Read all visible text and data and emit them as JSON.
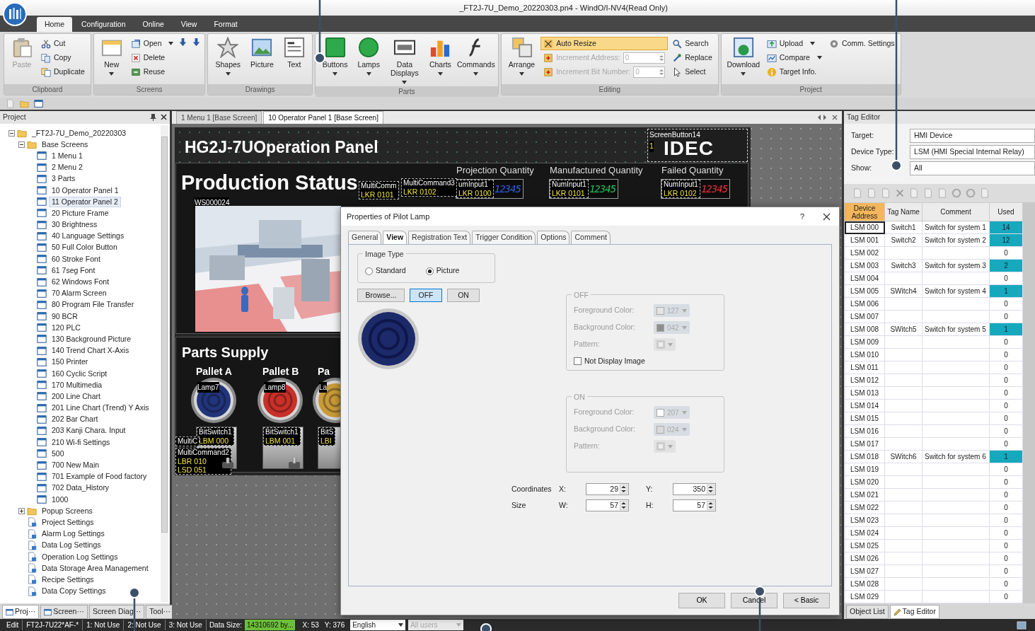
{
  "window": {
    "title": "_FT2J-7U_Demo_20220303.pn4 - WindO/I-NV4(Read Only)"
  },
  "ribbon_tabs": [
    {
      "label": "Home",
      "selected": true
    },
    {
      "label": "Configuration",
      "selected": false
    },
    {
      "label": "Online",
      "selected": false
    },
    {
      "label": "View",
      "selected": false
    },
    {
      "label": "Format",
      "selected": false
    }
  ],
  "ribbon_groups": [
    {
      "label": "Clipboard",
      "columns": [
        [
          {
            "kind": "large",
            "label": "Paste",
            "disabled": true
          }
        ],
        [
          {
            "kind": "small",
            "label": "Cut"
          },
          {
            "kind": "small",
            "label": "Copy"
          },
          {
            "kind": "small",
            "label": "Duplicate"
          }
        ]
      ]
    },
    {
      "label": "Screens",
      "columns": [
        [
          {
            "kind": "large",
            "label": "New",
            "dropdown": true
          }
        ],
        [
          {
            "kind": "small",
            "label": "Open",
            "dropdown": true
          },
          {
            "kind": "small",
            "label": "Delete"
          },
          {
            "kind": "small",
            "label": "Reuse"
          }
        ],
        [
          {
            "kind": "icon"
          },
          {
            "kind": "icon"
          }
        ]
      ]
    },
    {
      "label": "Drawings",
      "columns": [
        [
          {
            "kind": "large",
            "label": "Shapes",
            "dropdown": true
          }
        ],
        [
          {
            "kind": "large",
            "label": "Picture"
          }
        ],
        [
          {
            "kind": "large",
            "label": "Text"
          }
        ]
      ]
    },
    {
      "label": "Parts",
      "columns": [
        [
          {
            "kind": "large",
            "label": "Buttons",
            "dropdown": true
          }
        ],
        [
          {
            "kind": "large",
            "label": "Lamps",
            "dropdown": true
          }
        ],
        [
          {
            "kind": "large",
            "label": "Data Displays",
            "dropdown": true
          }
        ],
        [
          {
            "kind": "large",
            "label": "Charts",
            "dropdown": true
          }
        ],
        [
          {
            "kind": "large",
            "label": "Commands",
            "dropdown": true
          }
        ]
      ]
    },
    {
      "label": "Editing",
      "columns": [
        [
          {
            "kind": "large",
            "label": "Arrange",
            "dropdown": true
          }
        ],
        [
          {
            "kind": "small",
            "label": "Auto Resize",
            "highlighted": true
          },
          {
            "kind": "spin",
            "label": "Increment Address:",
            "value": "0",
            "disabled": true
          },
          {
            "kind": "spin",
            "label": "Increment Bit Number:",
            "value": "0",
            "disabled": true
          }
        ],
        [
          {
            "kind": "small",
            "label": "Search"
          },
          {
            "kind": "small",
            "label": "Replace"
          },
          {
            "kind": "small",
            "label": "Select"
          }
        ]
      ]
    },
    {
      "label": "Project",
      "columns": [
        [
          {
            "kind": "large",
            "label": "Download",
            "dropdown": true
          }
        ],
        [
          {
            "kind": "small",
            "label": "Upload",
            "dropdown": true
          },
          {
            "kind": "small",
            "label": "Compare",
            "dropdown": true
          },
          {
            "kind": "small",
            "label": "Target Info."
          }
        ],
        [
          {
            "kind": "small",
            "label": "Comm. Settings"
          }
        ]
      ]
    }
  ],
  "project": {
    "title": "Project",
    "tree": [
      {
        "label": "_FT2J-7U_Demo_20220303",
        "kind": "folder",
        "expanded": true,
        "selected": false,
        "children": [
          {
            "label": "Base Screens",
            "kind": "folder",
            "expanded": true,
            "selected": false,
            "children": [
              {
                "label": "1 Menu 1",
                "kind": "screen",
                "selected": false
              },
              {
                "label": "2 Menu 2",
                "kind": "screen",
                "selected": false
              },
              {
                "label": "3 Parts",
                "kind": "screen",
                "selected": false
              },
              {
                "label": "10 Operator Panel 1",
                "kind": "screen",
                "selected": false
              },
              {
                "label": "11 Operator Panel 2",
                "kind": "screen",
                "selected": true
              },
              {
                "label": "20 Picture Frame",
                "kind": "screen",
                "selected": false
              },
              {
                "label": "30 Brightness",
                "kind": "screen",
                "selected": false
              },
              {
                "label": "40 Language Settings",
                "kind": "screen",
                "selected": false
              },
              {
                "label": "50 Full Color Button",
                "kind": "screen",
                "selected": false
              },
              {
                "label": "60 Stroke Font",
                "kind": "screen",
                "selected": false
              },
              {
                "label": "61 7seg Font",
                "kind": "screen",
                "selected": false
              },
              {
                "label": "62 Windows Font",
                "kind": "screen",
                "selected": false
              },
              {
                "label": "70 Alarm Screen",
                "kind": "screen",
                "selected": false
              },
              {
                "label": "80 Program File Transfer",
                "kind": "screen",
                "selected": false
              },
              {
                "label": "90 BCR",
                "kind": "screen",
                "selected": false
              },
              {
                "label": "120 PLC",
                "kind": "screen",
                "selected": false
              },
              {
                "label": "130 Background Picture",
                "kind": "screen",
                "selected": false
              },
              {
                "label": "140 Trend Chart X-Axis",
                "kind": "screen",
                "selected": false
              },
              {
                "label": "150 Printer",
                "kind": "screen",
                "selected": false
              },
              {
                "label": "160 Cyclic Script",
                "kind": "screen",
                "selected": false
              },
              {
                "label": "170 Multimedia",
                "kind": "screen",
                "selected": false
              },
              {
                "label": "200 Line Chart",
                "kind": "screen",
                "selected": false
              },
              {
                "label": "201 Line Chart (Trend) Y Axis",
                "kind": "screen",
                "selected": false
              },
              {
                "label": "202 Bar Chart",
                "kind": "screen",
                "selected": false
              },
              {
                "label": "203 Kanji Chara. Input",
                "kind": "screen",
                "selected": false
              },
              {
                "label": "210 Wi-fi Settings",
                "kind": "screen",
                "selected": false
              },
              {
                "label": "500",
                "kind": "screen",
                "selected": false
              },
              {
                "label": "700 New Main",
                "kind": "screen",
                "selected": false
              },
              {
                "label": "701 Example of Food factory",
                "kind": "screen",
                "selected": false
              },
              {
                "label": "702 Data_History",
                "kind": "screen",
                "selected": false
              },
              {
                "label": "1000",
                "kind": "screen",
                "selected": false
              }
            ]
          },
          {
            "label": "Popup Screens",
            "kind": "folder",
            "expanded": false,
            "selected": false
          },
          {
            "label": "Project Settings",
            "kind": "settings",
            "selected": false
          },
          {
            "label": "Alarm Log Settings",
            "kind": "settings",
            "selected": false
          },
          {
            "label": "Data Log Settings",
            "kind": "settings",
            "selected": false
          },
          {
            "label": "Operation Log Settings",
            "kind": "settings",
            "selected": false
          },
          {
            "label": "Data Storage Area Management",
            "kind": "settings",
            "selected": false
          },
          {
            "label": "Recipe Settings",
            "kind": "settings",
            "selected": false
          },
          {
            "label": "Data Copy Settings",
            "kind": "settings",
            "selected": false
          }
        ]
      }
    ],
    "tabs": [
      {
        "label": "Proj···",
        "selected": true
      },
      {
        "label": "Screen···",
        "selected": false
      },
      {
        "label": "Screen Diag···",
        "selected": false
      },
      {
        "label": "Tool···",
        "selected": false
      }
    ]
  },
  "editor": {
    "tabs": [
      {
        "label": "1 Menu 1 [Base Screen]",
        "selected": false
      },
      {
        "label": "10 Operator Panel 1 [Base Screen]",
        "selected": true
      }
    ],
    "screen": {
      "title": "HG2J-7UOperation Panel",
      "logo": {
        "object": "ScreenButton14",
        "tag": "1",
        "text": "IDEC"
      },
      "production": {
        "heading": "Production Status",
        "tags": [
          {
            "lines": [
              "MultiComm",
              "LKR 0101"
            ]
          },
          {
            "lines": [
              "MultiCommand3",
              "LKR 0102"
            ]
          }
        ],
        "quantities": [
          {
            "label": "Projection Quantity",
            "object": "umInput1",
            "device": "LKR 0100",
            "digits": "12345",
            "color": "#2f5fe8"
          },
          {
            "label": "Manufactured Quantity",
            "object": "NumInput1",
            "device": "LKR 0101",
            "digits": "12345",
            "color": "#21c05a"
          },
          {
            "label": "Failed Quantity",
            "object": "NumInput1",
            "device": "LKR 0102",
            "digits": "12345",
            "color": "#e8303a"
          }
        ],
        "picture_label": "WS000024"
      },
      "parts": {
        "heading": "Parts Supply",
        "pallets": [
          {
            "label": "Pallet A",
            "lamp": "Lamp7",
            "color": "#22347a",
            "switch": "BitSwitch1",
            "device": "LBM 000"
          },
          {
            "label": "Pallet B",
            "lamp": "Lamp8",
            "color": "#c8302a",
            "switch": "BitSwitch1",
            "device": "LBM 001"
          },
          {
            "label": "Pa",
            "lamp": "La",
            "color": "#c89a3a",
            "switch": "BitS",
            "device": "LBI"
          }
        ],
        "tags": [
          {
            "lines": [
              "MultiC"
            ]
          },
          {
            "lines": [
              "MultiCommand2",
              "LBR 010",
              "LSD 051"
            ]
          }
        ]
      }
    }
  },
  "dialog": {
    "title": "Properties of Pilot Lamp",
    "help": "?",
    "tabs": [
      {
        "label": "General",
        "selected": false
      },
      {
        "label": "View",
        "selected": true
      },
      {
        "label": "Registration Text",
        "selected": false
      },
      {
        "label": "Trigger Condition",
        "selected": false
      },
      {
        "label": "Options",
        "selected": false
      },
      {
        "label": "Comment",
        "selected": false
      }
    ],
    "image_type": {
      "label": "Image Type",
      "options": [
        {
          "label": "Standard",
          "selected": false
        },
        {
          "label": "Picture",
          "selected": true
        }
      ]
    },
    "buttons": [
      {
        "label": "Browse...",
        "selected": false
      },
      {
        "label": "OFF",
        "selected": true
      },
      {
        "label": "ON",
        "selected": false
      }
    ],
    "groups": [
      {
        "label": "OFF",
        "fields": [
          {
            "kind": "color",
            "label": "Foreground Color:",
            "value": "127",
            "color": "#e4e4e4"
          },
          {
            "kind": "color",
            "label": "Background Color:",
            "value": "042",
            "color": "#8e8e8e"
          },
          {
            "kind": "pattern",
            "label": "Pattern:"
          }
        ],
        "checkbox": {
          "label": "Not Display Image",
          "checked": false
        }
      },
      {
        "label": "ON",
        "fields": [
          {
            "kind": "color",
            "label": "Foreground Color:",
            "value": "207",
            "color": "#ffffff"
          },
          {
            "kind": "color",
            "label": "Background Color:",
            "value": "024",
            "color": "#dadada"
          },
          {
            "kind": "pattern",
            "label": "Pattern:"
          }
        ]
      }
    ],
    "position_rows": [
      {
        "label": "Coordinates",
        "fields": [
          {
            "label": "X:",
            "value": "29"
          },
          {
            "label": "Y:",
            "value": "350"
          }
        ]
      },
      {
        "label": "Size",
        "fields": [
          {
            "label": "W:",
            "value": "57"
          },
          {
            "label": "H:",
            "value": "57"
          }
        ]
      }
    ],
    "footer": [
      "OK",
      "Cancel",
      "< Basic"
    ]
  },
  "tag_editor": {
    "title": "Tag Editor",
    "fields": [
      {
        "label": "Target:",
        "value": "HMI Device"
      },
      {
        "label": "Device Type:",
        "value": "LSM (HMI Special Internal Relay)"
      },
      {
        "label": "Show:",
        "value": "All"
      }
    ],
    "columns": [
      "Device Address",
      "Tag Name",
      "Comment",
      "Used"
    ],
    "rows": [
      {
        "address": "LSM 000",
        "tag_name": "Switch1",
        "comment": "Switch for system 1",
        "used": "14",
        "highlighted": true,
        "selected": true
      },
      {
        "address": "LSM 001",
        "tag_name": "Switch2",
        "comment": "Switch for system 2",
        "used": "12",
        "highlighted": true,
        "selected": false
      },
      {
        "address": "LSM 002",
        "used": "0",
        "highlighted": false,
        "selected": false
      },
      {
        "address": "LSM 003",
        "tag_name": "Switch3",
        "comment": "Switch for system 3",
        "used": "2",
        "highlighted": true,
        "selected": false
      },
      {
        "address": "LSM 004",
        "used": "0",
        "highlighted": false,
        "selected": false
      },
      {
        "address": "LSM 005",
        "tag_name": "SWitch4",
        "comment": "Switch for system 4",
        "used": "1",
        "highlighted": true,
        "selected": false
      },
      {
        "address": "LSM 006",
        "used": "0",
        "highlighted": false,
        "selected": false
      },
      {
        "address": "LSM 007",
        "used": "0",
        "highlighted": false,
        "selected": false
      },
      {
        "address": "LSM 008",
        "tag_name": "SWitch5",
        "comment": "Switch for system 5",
        "used": "1",
        "highlighted": true,
        "selected": false
      },
      {
        "address": "LSM 009",
        "used": "0",
        "highlighted": false,
        "selected": false
      },
      {
        "address": "LSM 010",
        "used": "0",
        "highlighted": false,
        "selected": false
      },
      {
        "address": "LSM 011",
        "used": "0",
        "highlighted": false,
        "selected": false
      },
      {
        "address": "LSM 012",
        "used": "0",
        "highlighted": false,
        "selected": false
      },
      {
        "address": "LSM 013",
        "used": "0",
        "highlighted": false,
        "selected": false
      },
      {
        "address": "LSM 014",
        "used": "0",
        "highlighted": false,
        "selected": false
      },
      {
        "address": "LSM 015",
        "used": "0",
        "highlighted": false,
        "selected": false
      },
      {
        "address": "LSM 016",
        "used": "0",
        "highlighted": false,
        "selected": false
      },
      {
        "address": "LSM 017",
        "used": "0",
        "highlighted": false,
        "selected": false
      },
      {
        "address": "LSM 018",
        "tag_name": "SWitch6",
        "comment": "Switch for system 6",
        "used": "1",
        "highlighted": true,
        "selected": false
      },
      {
        "address": "LSM 019",
        "used": "0",
        "highlighted": false,
        "selected": false
      },
      {
        "address": "LSM 020",
        "used": "0",
        "highlighted": false,
        "selected": false
      },
      {
        "address": "LSM 021",
        "used": "0",
        "highlighted": false,
        "selected": false
      },
      {
        "address": "LSM 022",
        "used": "0",
        "highlighted": false,
        "selected": false
      },
      {
        "address": "LSM 023",
        "used": "0",
        "highlighted": false,
        "selected": false
      },
      {
        "address": "LSM 024",
        "used": "0",
        "highlighted": false,
        "selected": false
      },
      {
        "address": "LSM 025",
        "used": "0",
        "highlighted": false,
        "selected": false
      },
      {
        "address": "LSM 026",
        "used": "0",
        "highlighted": false,
        "selected": false
      },
      {
        "address": "LSM 027",
        "used": "0",
        "highlighted": false,
        "selected": false
      },
      {
        "address": "LSM 028",
        "used": "0",
        "highlighted": false,
        "selected": false
      },
      {
        "address": "LSM 029",
        "used": "0",
        "highlighted": false,
        "selected": false
      }
    ],
    "tabs": [
      {
        "label": "Object List",
        "selected": false
      },
      {
        "label": "Tag Editor",
        "selected": true
      }
    ]
  },
  "status_bar": [
    {
      "kind": "label",
      "text": "Edit"
    },
    {
      "kind": "label",
      "text": "FT2J-7U22*AF-*"
    },
    {
      "kind": "label",
      "text": "1: Not Use"
    },
    {
      "kind": "label",
      "text": "2: Not Use"
    },
    {
      "kind": "label",
      "text": "3: Not Use"
    },
    {
      "kind": "caption",
      "text": "Data Size:"
    },
    {
      "kind": "value",
      "text": "14310692 by..."
    },
    {
      "kind": "caption",
      "text": "X: 53"
    },
    {
      "kind": "caption",
      "text": "Y: 376"
    },
    {
      "kind": "dropdown",
      "text": "English",
      "disabled": false
    },
    {
      "kind": "dropdown",
      "text": "All users",
      "disabled": true
    }
  ]
}
